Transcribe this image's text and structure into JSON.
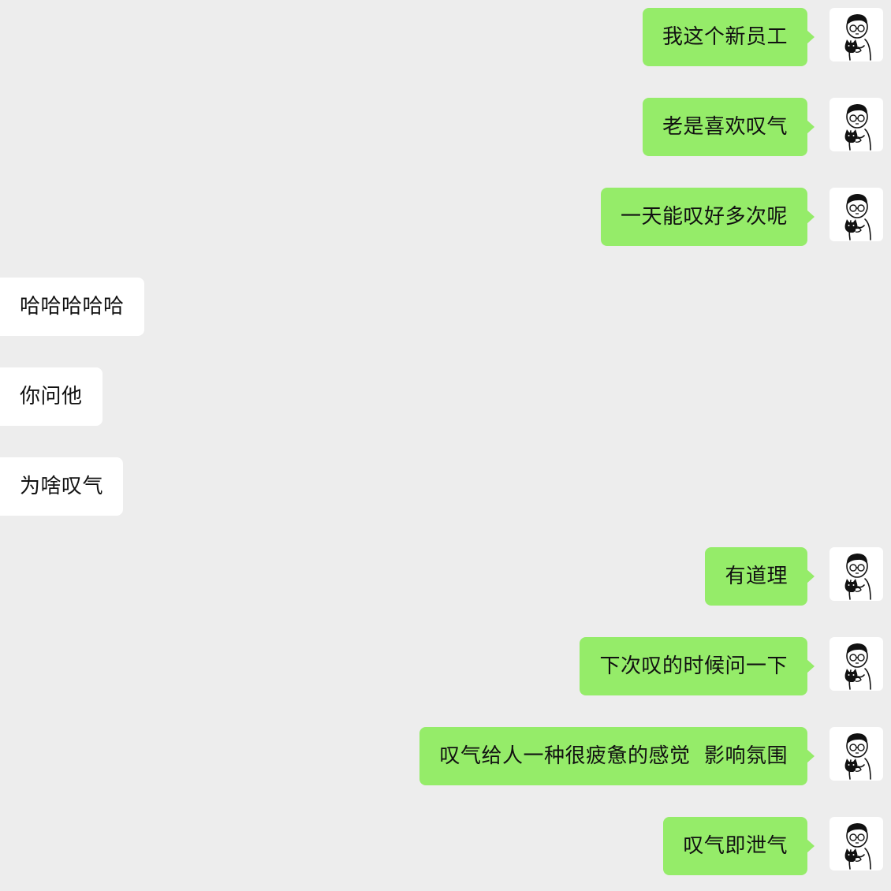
{
  "messages": [
    {
      "side": "self",
      "text": "我这个新员工"
    },
    {
      "side": "self",
      "text": "老是喜欢叹气"
    },
    {
      "side": "self",
      "text": "一天能叹好多次呢"
    },
    {
      "side": "other",
      "text": "哈哈哈哈哈"
    },
    {
      "side": "other",
      "text": "你问他"
    },
    {
      "side": "other",
      "text": "为啥叹气"
    },
    {
      "side": "self",
      "text": "有道理"
    },
    {
      "side": "self",
      "text": "下次叹的时候问一下"
    },
    {
      "side": "self",
      "text": "叹气给人一种很疲惫的感觉  影响氛围"
    },
    {
      "side": "self",
      "text": "叹气即泄气"
    }
  ],
  "colors": {
    "background": "#ededed",
    "self_bubble": "#95ec69",
    "other_bubble": "#ffffff"
  },
  "icons": {
    "avatar": "avatar-boy-with-glasses-holding-cat"
  }
}
